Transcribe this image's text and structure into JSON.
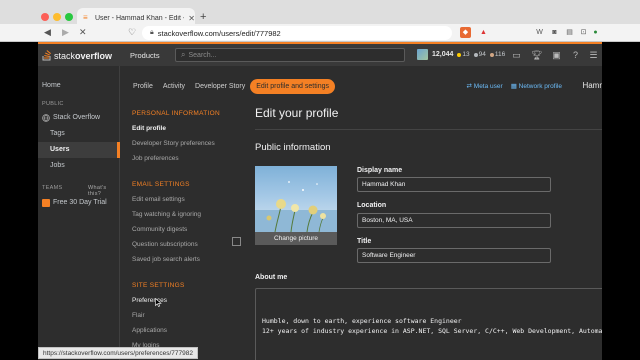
{
  "browser": {
    "tab_title": "User - Hammad Khan - Edit - St",
    "url": "stackoverflow.com/users/edit/777982",
    "status_url": "https://stackoverflow.com/users/preferences/777982"
  },
  "topbar": {
    "logo_light": "stack",
    "logo_bold": "overflow",
    "products": "Products",
    "search_placeholder": "Search...",
    "reputation": "12,044",
    "gold": "13",
    "silver": "94",
    "bronze": "116"
  },
  "leftnav": {
    "home": "Home",
    "public": "PUBLIC",
    "stack_overflow": "Stack Overflow",
    "tags": "Tags",
    "users": "Users",
    "jobs": "Jobs",
    "teams": "TEAMS",
    "whats_this": "What's this?",
    "trial": "Free 30 Day Trial"
  },
  "profile_tabs": [
    "Profile",
    "Activity",
    "Developer Story",
    "Edit profile and settings"
  ],
  "meta": {
    "meta_user": "Meta user",
    "network_profile": "Network profile",
    "name_cut": "Hamm"
  },
  "settings_nav": {
    "personal_head": "PERSONAL INFORMATION",
    "personal_items": [
      "Edit profile",
      "Developer Story preferences",
      "Job preferences"
    ],
    "email_head": "EMAIL SETTINGS",
    "email_items": [
      "Edit email settings",
      "Tag watching & ignoring",
      "Community digests",
      "Question subscriptions",
      "Saved job search alerts"
    ],
    "site_head": "SITE SETTINGS",
    "site_items": [
      "Preferences",
      "Flair",
      "Applications",
      "My logins"
    ]
  },
  "form": {
    "title": "Edit your profile",
    "section": "Public information",
    "change_picture": "Change picture",
    "display_name_label": "Display name",
    "display_name": "Hammad Khan",
    "location_label": "Location",
    "location": "Boston, MA, USA",
    "title_label": "Title",
    "title_value": "Software Engineer",
    "about_label": "About me",
    "bio_line1": "Humble, down to earth, experience software Engineer",
    "bio_line2": "12+ years of industry experience in ASP.NET, SQL Server, C/C++, Web Development, Automati"
  },
  "colors": {
    "accent": "#f48024",
    "link": "#6cbbf7",
    "page_bg": "#2d2d2d"
  }
}
